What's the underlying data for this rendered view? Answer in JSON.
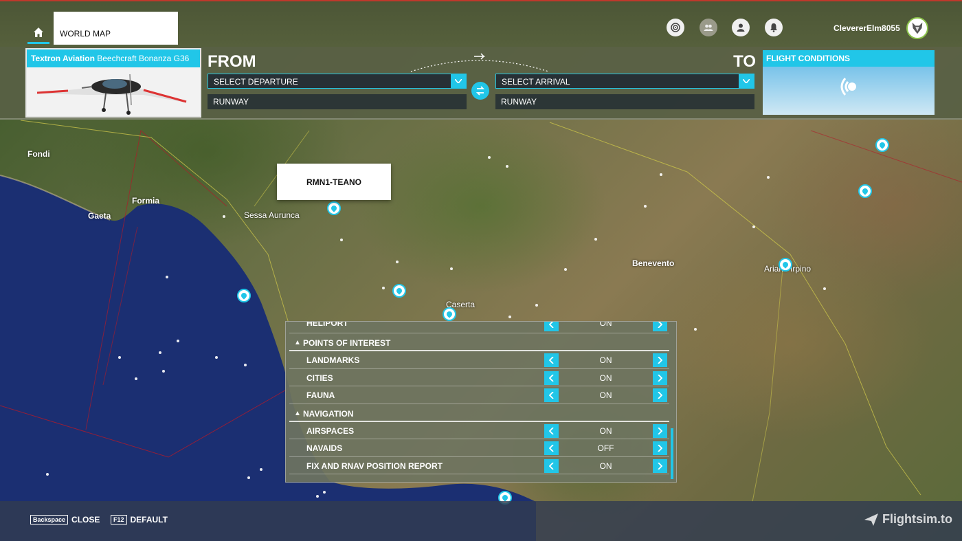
{
  "topbar": {
    "world_map_tab": "WORLD MAP",
    "username": "ClevererElm8055",
    "icons": [
      "radar-icon",
      "friends-icon",
      "profile-icon",
      "notifications-icon"
    ]
  },
  "planner": {
    "aircraft_brand": "Textron Aviation",
    "aircraft_model": "Beechcraft Bonanza G36",
    "from_label": "FROM",
    "to_label": "TO",
    "departure_placeholder": "SELECT DEPARTURE",
    "arrival_placeholder": "SELECT ARRIVAL",
    "departure_runway": "RUNWAY",
    "arrival_runway": "RUNWAY",
    "conditions_title": "FLIGHT CONDITIONS"
  },
  "map": {
    "cities": [
      "Fondi",
      "Formia",
      "Gaeta",
      "Sessa Aurunca",
      "Benevento",
      "Ariano Irpino",
      "Caserta"
    ],
    "airport_popup": "RMN1-TEANO"
  },
  "settings": {
    "partial_row": {
      "label": "HELIPORT",
      "value": "ON"
    },
    "sections": [
      {
        "title": "POINTS OF INTEREST",
        "options": [
          {
            "label": "LANDMARKS",
            "value": "ON"
          },
          {
            "label": "CITIES",
            "value": "ON"
          },
          {
            "label": "FAUNA",
            "value": "ON"
          }
        ]
      },
      {
        "title": "NAVIGATION",
        "options": [
          {
            "label": "AIRSPACES",
            "value": "ON"
          },
          {
            "label": "NAVAIDS",
            "value": "OFF"
          },
          {
            "label": "FIX AND RNAV POSITION REPORT",
            "value": "ON"
          }
        ]
      }
    ]
  },
  "bottombar": {
    "close_key": "Backspace",
    "close_label": "CLOSE",
    "default_key": "F12",
    "default_label": "DEFAULT",
    "watermark": "Flightsim.to"
  },
  "colors": {
    "accent": "#21c6e8",
    "sea": "#1a2e6e",
    "topbar": "#52603a"
  }
}
